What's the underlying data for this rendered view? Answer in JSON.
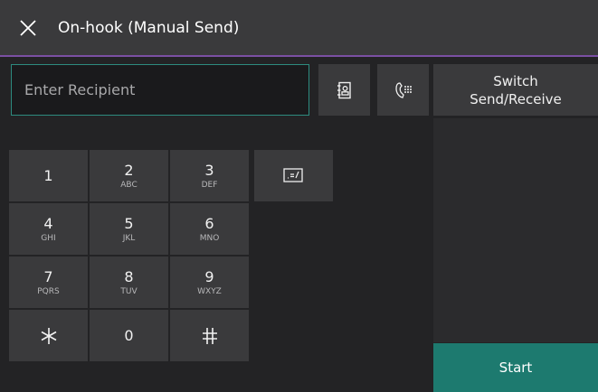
{
  "header": {
    "title": "On-hook (Manual Send)",
    "close_icon": "close-icon"
  },
  "recipient": {
    "placeholder": "Enter Recipient",
    "value": ""
  },
  "toolbar": {
    "address_book_icon": "address-book-icon",
    "dial_pause_icon": "dial-keypad-icon"
  },
  "switch": {
    "line1": "Switch",
    "line2": "Send/Receive"
  },
  "start": {
    "label": "Start"
  },
  "keypad": {
    "k1": {
      "digit": "1",
      "letters": ""
    },
    "k2": {
      "digit": "2",
      "letters": "ABC"
    },
    "k3": {
      "digit": "3",
      "letters": "DEF"
    },
    "k4": {
      "digit": "4",
      "letters": "GHI"
    },
    "k5": {
      "digit": "5",
      "letters": "JKL"
    },
    "k6": {
      "digit": "6",
      "letters": "MNO"
    },
    "k7": {
      "digit": "7",
      "letters": "PQRS"
    },
    "k8": {
      "digit": "8",
      "letters": "TUV"
    },
    "k9": {
      "digit": "9",
      "letters": "WXYZ"
    },
    "kstar": {
      "digit": "*",
      "letters": ""
    },
    "k0": {
      "digit": "0",
      "letters": ""
    },
    "khash": {
      "digit": "#",
      "letters": ""
    }
  },
  "edit": {
    "icon": "special-character-icon"
  },
  "colors": {
    "accent_line": "#7a4fa3",
    "start": "#1d7a6f",
    "input_border": "#2d8b7f"
  }
}
